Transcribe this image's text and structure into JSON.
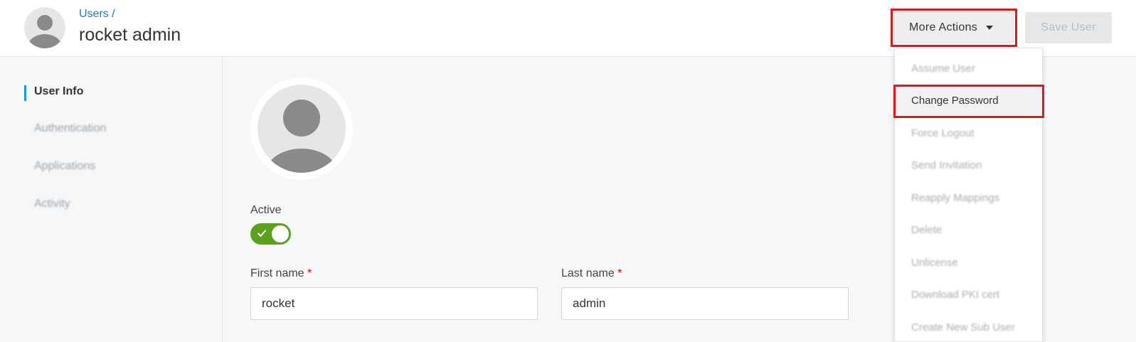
{
  "header": {
    "breadcrumb": "Users /",
    "title": "rocket admin",
    "more_actions_label": "More Actions",
    "save_label": "Save User"
  },
  "sidebar": {
    "items": [
      {
        "label": "User Info",
        "active": true
      },
      {
        "label": "Authentication",
        "active": false
      },
      {
        "label": "Applications",
        "active": false
      },
      {
        "label": "Activity",
        "active": false
      }
    ]
  },
  "form": {
    "active_label": "Active",
    "active": true,
    "first_name_label": "First name",
    "first_name_value": "rocket",
    "last_name_label": "Last name",
    "last_name_value": "admin",
    "required_marker": "*"
  },
  "dropdown": {
    "items": [
      "Assume User",
      "Change Password",
      "Force Logout",
      "Send Invitation",
      "Reapply Mappings",
      "Delete",
      "Unlicense",
      "Download PKI cert",
      "Create New Sub User"
    ]
  },
  "colors": {
    "accent": "#1a9ad6",
    "link": "#1a7fb0",
    "toggle_on": "#5aa21b",
    "highlight": "#e8141b",
    "required": "#d0021b"
  },
  "icons": {
    "header_avatar": "user-avatar-icon",
    "profile_avatar": "user-avatar-icon",
    "caret": "caret-down-icon",
    "toggle_check": "check-icon"
  }
}
